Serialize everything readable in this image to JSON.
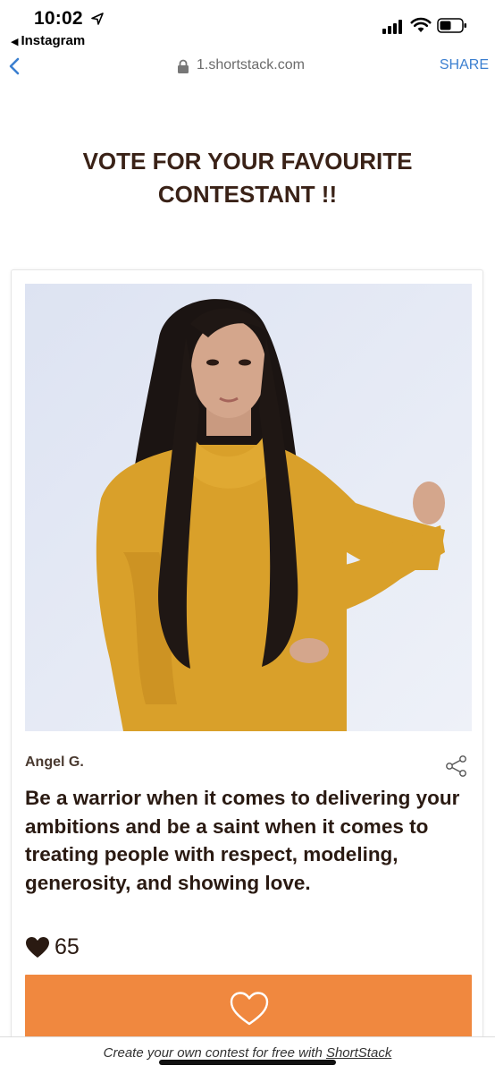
{
  "status_bar": {
    "time": "10:02",
    "back_app": "Instagram"
  },
  "browser": {
    "url": "1.shortstack.com",
    "share_label": "SHARE"
  },
  "page": {
    "title_line1": "VOTE FOR YOUR FAVOURITE",
    "title_line2": "CONTESTANT !!"
  },
  "entry": {
    "name": "Angel G.",
    "quote": "Be a warrior when it comes to delivering your ambitions and be a saint when it comes to treating people with respect, modeling, generosity, and showing love.",
    "vote_count": "65",
    "photo_icon": "contestant-photo"
  },
  "footer": {
    "prefix": "Create your own contest for free with ",
    "brand": "ShortStack"
  },
  "colors": {
    "accent": "#f0883f",
    "link": "#3b7fd0",
    "title": "#3a2217"
  }
}
